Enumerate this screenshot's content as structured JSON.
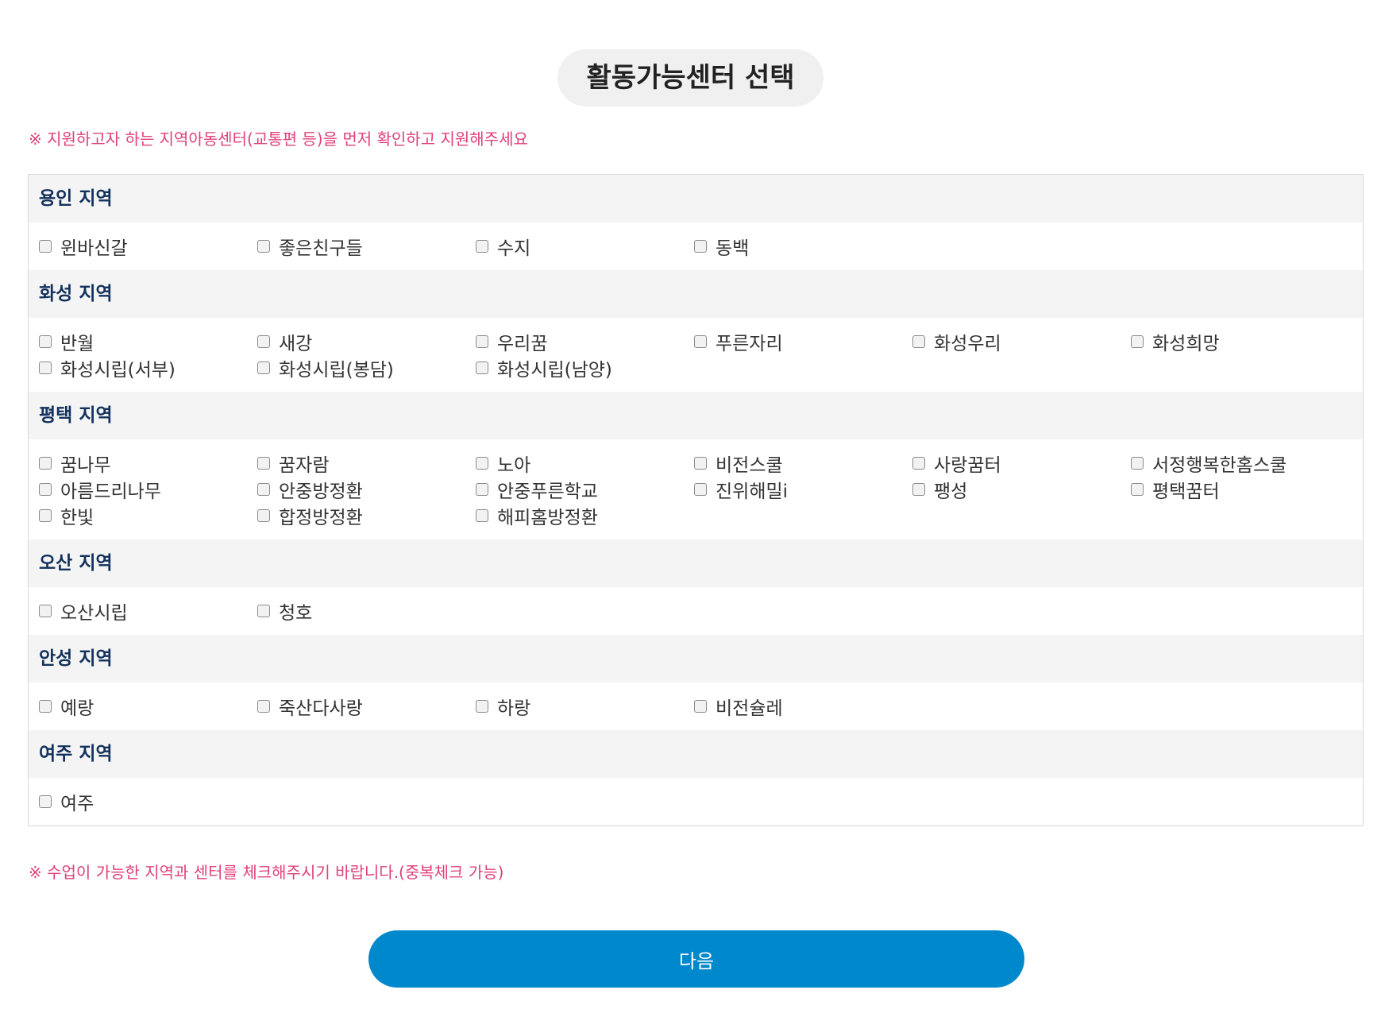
{
  "page_title": "활동가능센터 선택",
  "notice_top": "※ 지원하고자 하는 지역아동센터(교통편 등)을 먼저 확인하고 지원해주세요",
  "notice_bottom": "※ 수업이 가능한 지역과 센터를 체크해주시기 바랍니다.(중복체크 가능)",
  "colors": {
    "notice": "#e0407a",
    "region_heading": "#13315c",
    "button": "#0088cc",
    "heading_background": "#f4f4f4"
  },
  "regions": [
    {
      "name": "용인 지역",
      "centers": [
        "윈바신갈",
        "좋은친구들",
        "수지",
        "동백"
      ]
    },
    {
      "name": "화성 지역",
      "centers": [
        "반월",
        "새강",
        "우리꿈",
        "푸른자리",
        "화성우리",
        "화성희망",
        "화성시립(서부)",
        "화성시립(봉담)",
        "화성시립(남양)"
      ]
    },
    {
      "name": "평택 지역",
      "centers": [
        "꿈나무",
        "꿈자람",
        "노아",
        "비전스쿨",
        "사랑꿈터",
        "서정행복한홈스쿨",
        "아름드리나무",
        "안중방정환",
        "안중푸른학교",
        "진위해밀i",
        "팽성",
        "평택꿈터",
        "한빛",
        "합정방정환",
        "해피홈방정환"
      ]
    },
    {
      "name": "오산 지역",
      "centers": [
        "오산시립",
        "청호"
      ]
    },
    {
      "name": "안성 지역",
      "centers": [
        "예랑",
        "죽산다사랑",
        "하랑",
        "비전슐레"
      ]
    },
    {
      "name": "여주 지역",
      "centers": [
        "여주"
      ]
    }
  ],
  "next_button": "다음"
}
